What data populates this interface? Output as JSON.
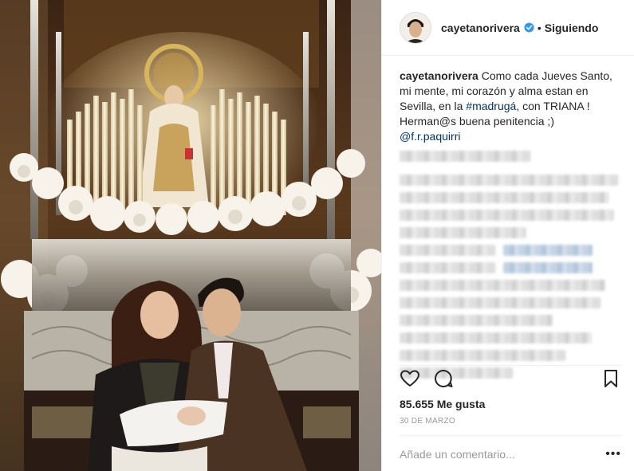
{
  "post": {
    "photo_alt": "",
    "header": {
      "username": "cayetanorivera",
      "separator": "•",
      "follow_status": "Siguiendo"
    },
    "caption": {
      "username": "cayetanorivera",
      "text_before": " Como cada Jueves Santo, mi mente, mi corazón y alma estan en Sevilla, en la ",
      "hashtag": "#madrugá",
      "text_after": ", con TRIANA ! Herman@s buena penitencia ;)",
      "mention": "@f.r.paquirri"
    },
    "likes": "85.655 Me gusta",
    "date": "30 DE MARZO",
    "comment_placeholder": "Añade un comentario...",
    "more": "•••",
    "colors": {
      "text": "#262626",
      "link": "#003569",
      "muted": "#999999",
      "verified": "#3897f0",
      "border": "#efefef"
    },
    "icons": {
      "like": "heart-outline-icon",
      "comment": "comment-bubble-icon",
      "save": "bookmark-icon",
      "verified": "verified-badge-icon"
    }
  }
}
